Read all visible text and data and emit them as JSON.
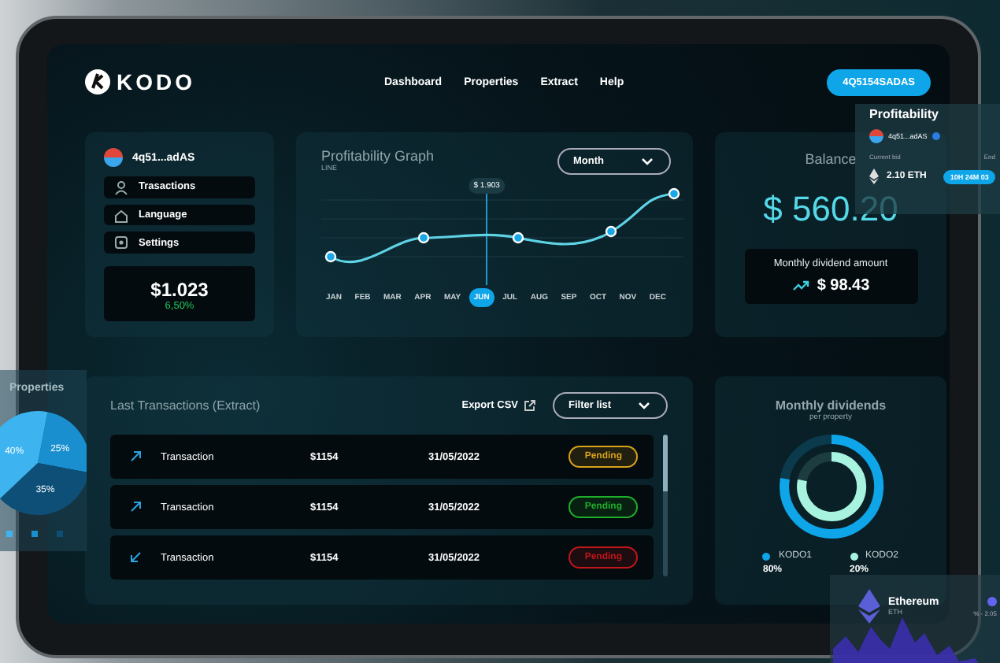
{
  "header": {
    "logo": "KODO",
    "nav": [
      {
        "label": "Dashboard"
      },
      {
        "label": "Properties"
      },
      {
        "label": "Extract"
      },
      {
        "label": "Help"
      }
    ],
    "wallet_button": "4Q5154SADAS"
  },
  "profile": {
    "name": "4q51...adAS",
    "menu": [
      {
        "label": "Trasactions"
      },
      {
        "label": "Language"
      },
      {
        "label": "Settings"
      }
    ],
    "amount": "$1.023",
    "change": "6,50%"
  },
  "graph": {
    "title": "Profitability Graph",
    "subtitle": "LINE",
    "period": "Month",
    "tooltip": "$ 1.903",
    "months": [
      {
        "label": "JAN",
        "selected": false
      },
      {
        "label": "FEB",
        "selected": false
      },
      {
        "label": "MAR",
        "selected": false
      },
      {
        "label": "APR",
        "selected": false
      },
      {
        "label": "MAY",
        "selected": false
      },
      {
        "label": "JUN",
        "selected": true
      },
      {
        "label": "JUL",
        "selected": false
      },
      {
        "label": "AUG",
        "selected": false
      },
      {
        "label": "SEP",
        "selected": false
      },
      {
        "label": "OCT",
        "selected": false
      },
      {
        "label": "NOV",
        "selected": false
      },
      {
        "label": "DEC",
        "selected": false
      }
    ]
  },
  "balance": {
    "title": "Balance",
    "amount": "$ 560.20",
    "dividend_label": "Monthly dividend amount",
    "dividend": "$ 98.43"
  },
  "transactions": {
    "title": "Last Transactions (Extract)",
    "export": "Export CSV",
    "filter": "Filter list",
    "rows": [
      {
        "kind": "up",
        "name": "Transaction",
        "amount": "$1154",
        "date": "31/05/2022",
        "status": "Pending",
        "color": "#d9a21b"
      },
      {
        "kind": "up",
        "name": "Transaction",
        "amount": "$1154",
        "date": "31/05/2022",
        "status": "Pending",
        "color": "#1fae2a"
      },
      {
        "kind": "down",
        "name": "Transaction",
        "amount": "$1154",
        "date": "31/05/2022",
        "status": "Pending",
        "color": "#c0161b"
      }
    ]
  },
  "dividends": {
    "title": "Monthly dividends",
    "subtitle": "per property",
    "legend": [
      {
        "name": "KODO1",
        "share": "80%",
        "color": "#0ea5e9"
      },
      {
        "name": "KODO2",
        "share": "20%",
        "color": "#a7f3e0"
      }
    ]
  },
  "profit_card": {
    "title": "Profitability",
    "name": "4q51...adAS",
    "bid_label": "Current bid",
    "bid": "2.10 ETH",
    "end_label": "End",
    "timer": "10H 24M 03"
  },
  "properties_card": {
    "chart_data": {
      "type": "pie",
      "title": "Properties",
      "values": [
        40,
        25,
        35
      ],
      "value_labels": [
        "40%",
        "25%",
        "35%"
      ]
    }
  },
  "eth_card": {
    "name": "Ethereum",
    "symbol": "ETH",
    "change": "% - 2.05"
  }
}
